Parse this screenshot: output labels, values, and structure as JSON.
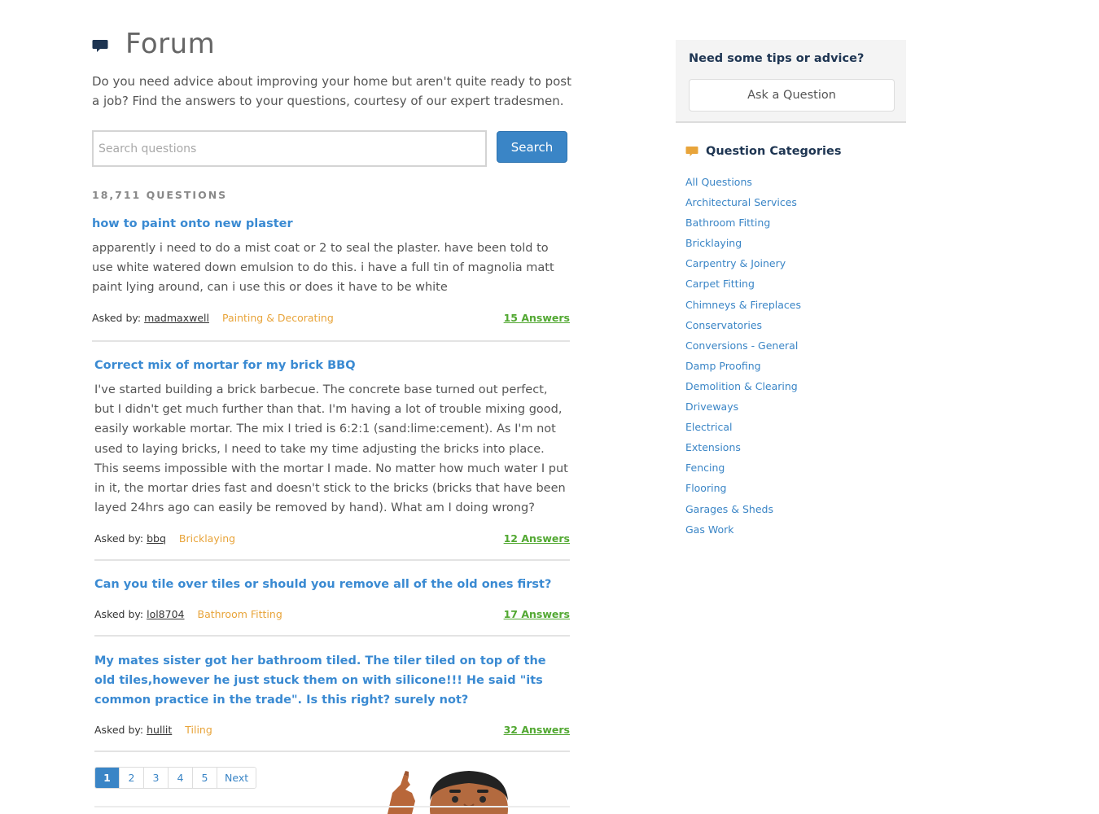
{
  "header": {
    "title": "Forum",
    "icon": "speech-bubble-icon"
  },
  "intro": "Do you need advice about improving your home but aren't quite ready to post a job? Find the answers to your questions, courtesy of our expert tradesmen.",
  "search": {
    "placeholder": "Search questions",
    "value": "",
    "button_label": "Search"
  },
  "question_count": "18,711 QUESTIONS",
  "questions": [
    {
      "title": "how to paint onto new plaster",
      "body": "apparently i need to do a mist coat or 2 to seal the plaster. have been told to use white watered down emulsion to do this. i have a full tin of magnolia matt paint lying around, can i use this or does it have to be white",
      "asked_label": "Asked by:",
      "user": "madmaxwell",
      "category": "Painting & Decorating",
      "answers": "15 Answers"
    },
    {
      "title": "Correct mix of mortar for my brick BBQ",
      "body": "I've started building a brick barbecue. The concrete base turned out perfect, but I didn't get much further than that. I'm having a lot of trouble mixing good, easily workable mortar. The mix I tried is 6:2:1 (sand:lime:cement). As I'm not used to laying bricks, I need to take my time adjusting the bricks into place. This seems impossible with the mortar I made. No matter how much water I put in it, the mortar dries fast and doesn't stick to the bricks (bricks that have been layed 24hrs ago can easily be removed by hand). What am I doing wrong?",
      "asked_label": "Asked by:",
      "user": "bbq",
      "category": "Bricklaying",
      "answers": "12 Answers"
    },
    {
      "title": "Can you tile over tiles or should you remove all of the old ones first?",
      "body": "",
      "asked_label": "Asked by:",
      "user": "lol8704",
      "category": "Bathroom Fitting",
      "answers": "17 Answers"
    },
    {
      "title": "My mates sister got her bathroom tiled. The tiler tiled on top of the old tiles,however he just stuck them on with silicone!!! He said \"its common practice in the trade\". Is this right? surely not?",
      "body": "",
      "asked_label": "Asked by:",
      "user": "hullit",
      "category": "Tiling",
      "answers": "32 Answers"
    }
  ],
  "pagination": {
    "pages": [
      "1",
      "2",
      "3",
      "4",
      "5"
    ],
    "current": "1",
    "next_label": "Next"
  },
  "sidebar": {
    "tips_heading": "Need some tips or advice?",
    "ask_button": "Ask a Question",
    "categories_title": "Question Categories",
    "categories_icon": "speech-bubble-icon",
    "categories": [
      "All Questions",
      "Architectural Services",
      "Bathroom Fitting",
      "Bricklaying",
      "Carpentry & Joinery",
      "Carpet Fitting",
      "Chimneys & Fireplaces",
      "Conservatories",
      "Conversions - General",
      "Damp Proofing",
      "Demolition & Clearing",
      "Driveways",
      "Electrical",
      "Extensions",
      "Fencing",
      "Flooring",
      "Garages & Sheds",
      "Gas Work"
    ]
  },
  "colors": {
    "link_blue": "#3a8ad2",
    "button_blue": "#3a85c6",
    "category_orange": "#e8a43a",
    "answers_green": "#52a832",
    "heading_navy": "#1e3552"
  }
}
